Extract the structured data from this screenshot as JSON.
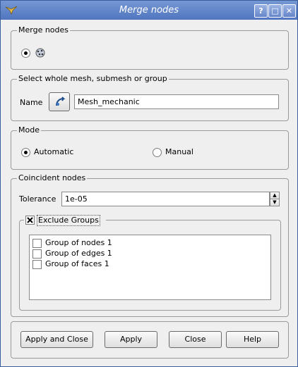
{
  "window": {
    "title": "Merge nodes",
    "title_buttons": [
      "?",
      "□",
      "✕"
    ]
  },
  "merge_nodes": {
    "group_title": "Merge nodes",
    "option_icon": "merge-nodes-icon"
  },
  "selection": {
    "group_title": "Select whole mesh, submesh or group",
    "name_label": "Name",
    "name_value": "Mesh_mechanic",
    "select_icon": "selection-arrow-icon"
  },
  "mode": {
    "group_title": "Mode",
    "automatic_label": "Automatic",
    "manual_label": "Manual",
    "selected": "Automatic"
  },
  "coincident": {
    "group_title": "Coincident nodes",
    "tolerance_label": "Tolerance",
    "tolerance_value": "1e-05",
    "exclude_groups_label": "Exclude Groups",
    "exclude_groups_checked": true,
    "groups": [
      {
        "label": "Group of nodes 1",
        "checked": false
      },
      {
        "label": "Group of edges 1",
        "checked": false
      },
      {
        "label": "Group of faces 1",
        "checked": false
      }
    ]
  },
  "buttons": {
    "apply_close": "Apply and Close",
    "apply": "Apply",
    "close": "Close",
    "help": "Help"
  },
  "colors": {
    "titlebar": "#5a7ec6",
    "dialog_bg": "#efefef"
  }
}
